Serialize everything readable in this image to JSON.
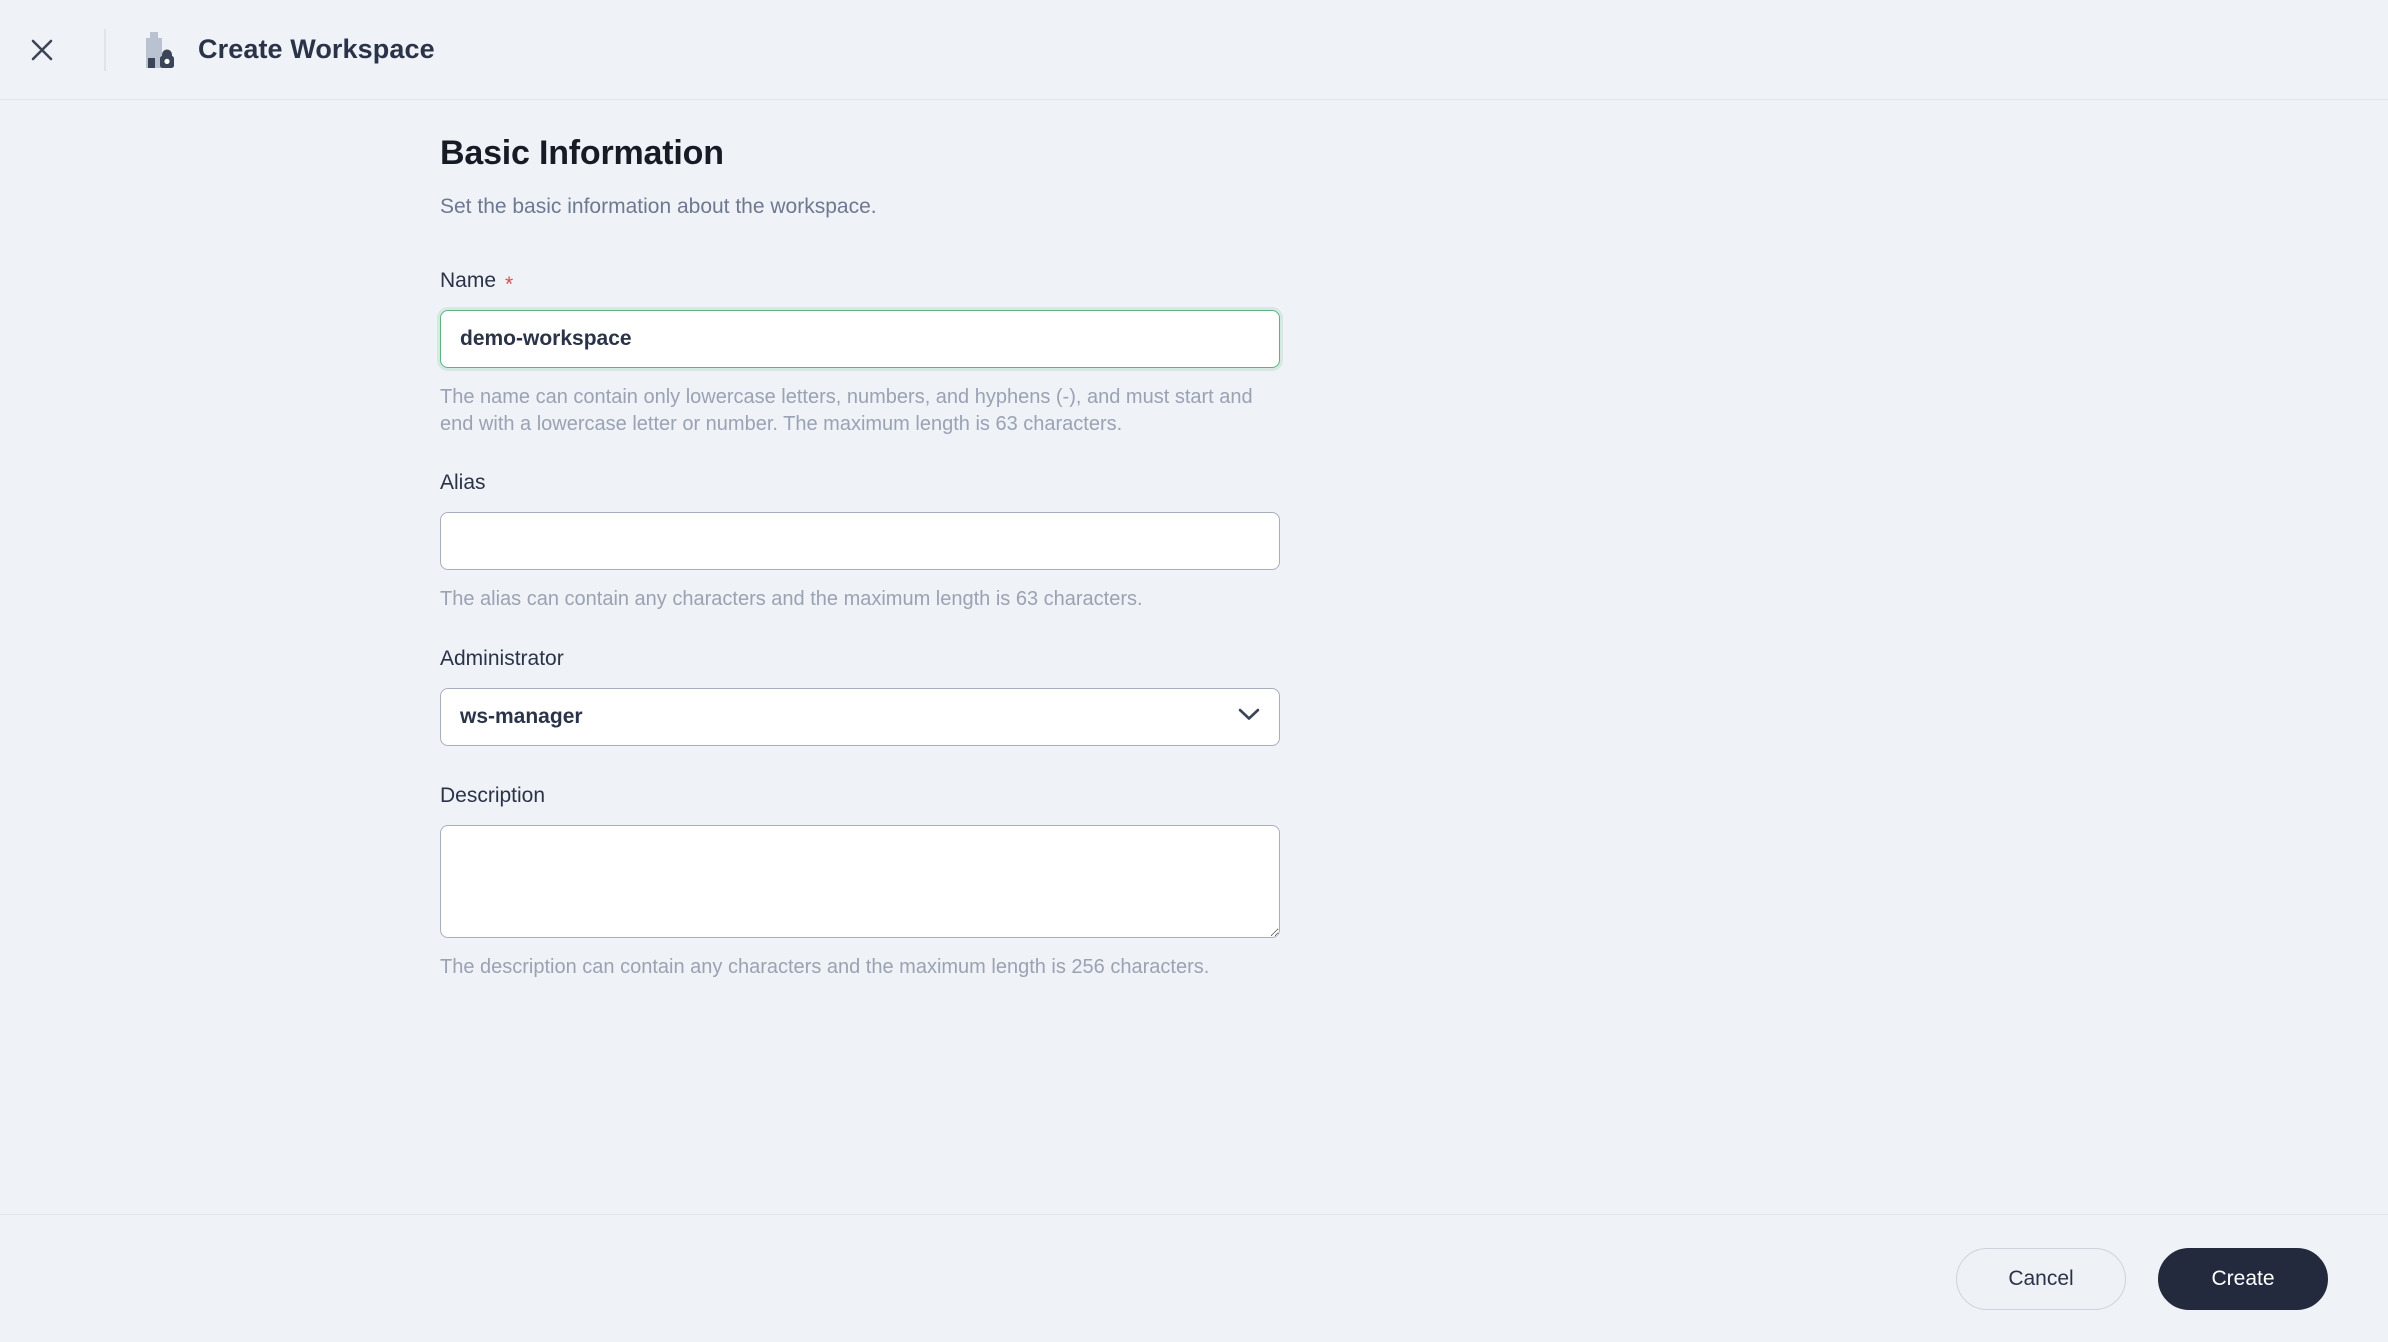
{
  "header": {
    "close_icon": "close-icon",
    "workspace_icon": "workspace-lock-icon",
    "title": "Create Workspace"
  },
  "form": {
    "section_title": "Basic Information",
    "section_subtitle": "Set the basic information about the workspace.",
    "fields": {
      "name": {
        "label": "Name",
        "required_marker": "*",
        "value": "demo-workspace",
        "placeholder": "",
        "helper": "The name can contain only lowercase letters, numbers, and hyphens (-), and must start and end with a lowercase letter or number. The maximum length is 63 characters.",
        "state": "valid",
        "valid_border_color": "#5cb37f"
      },
      "alias": {
        "label": "Alias",
        "value": "",
        "placeholder": "",
        "helper": "The alias can contain any characters and the maximum length is 63 characters."
      },
      "administrator": {
        "label": "Administrator",
        "value": "ws-manager",
        "chevron_icon": "chevron-down-icon",
        "options": [
          "ws-manager"
        ]
      },
      "description": {
        "label": "Description",
        "value": "",
        "placeholder": "",
        "helper": "The description can contain any characters and the maximum length is 256 characters."
      }
    }
  },
  "footer": {
    "cancel_label": "Cancel",
    "create_label": "Create"
  },
  "colors": {
    "page_background": "#eff2f6",
    "primary_button": "#232a3d",
    "text_primary": "#2b3348",
    "text_muted": "#9aa2b3",
    "required_star": "#d5514a",
    "valid_green": "#5cb37f"
  }
}
